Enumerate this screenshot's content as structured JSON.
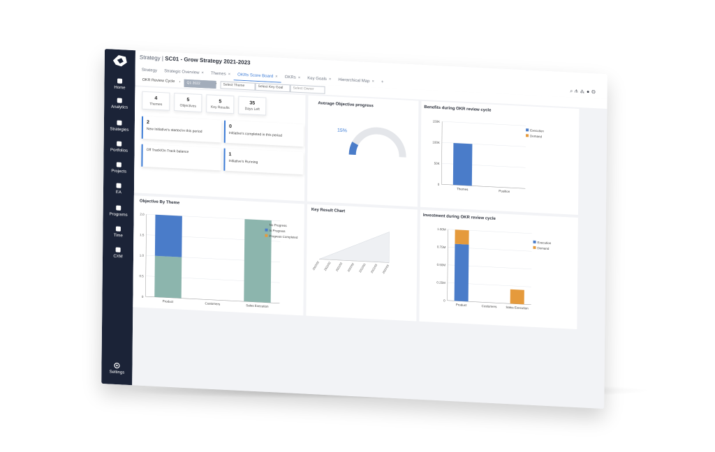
{
  "app": {
    "breadcrumb_prefix": "Strategy |",
    "breadcrumb_title": "SC01 - Grow Strategy 2021-2023"
  },
  "sidebar": {
    "items": [
      {
        "label": "Home",
        "icon": "home-icon"
      },
      {
        "label": "Analytics",
        "icon": "analytics-icon"
      },
      {
        "label": "Strategies",
        "icon": "strategy-icon"
      },
      {
        "label": "Portfolios",
        "icon": "portfolio-icon"
      },
      {
        "label": "Projects",
        "icon": "project-icon"
      },
      {
        "label": "EA",
        "icon": "ea-icon"
      },
      {
        "label": "Programs",
        "icon": "program-icon"
      },
      {
        "label": "Time",
        "icon": "time-icon"
      },
      {
        "label": "CXM",
        "icon": "cxm-icon"
      }
    ],
    "settings_label": "Settings"
  },
  "tabs": [
    {
      "label": "Strategy",
      "closable": false,
      "active": false
    },
    {
      "label": "Strategic Overview",
      "closable": true,
      "active": false
    },
    {
      "label": "Themes",
      "closable": true,
      "active": false
    },
    {
      "label": "OKRs Score Board",
      "closable": true,
      "active": true
    },
    {
      "label": "OKRs",
      "closable": true,
      "active": false
    },
    {
      "label": "Key Goals",
      "closable": true,
      "active": false
    },
    {
      "label": "Hierarchical Map",
      "closable": true,
      "active": false
    }
  ],
  "tab_add": "+",
  "tab_close": "×",
  "filters": {
    "cycle_label": "OKR Review Cycle",
    "cycle_value": "Q1 2022",
    "prev": "‹",
    "next": "›",
    "theme": "Select Theme",
    "goal": "Select Key Goal",
    "owner": "Select Owner"
  },
  "stats": [
    {
      "value": "4",
      "label": "Themes"
    },
    {
      "value": "5",
      "label": "Objectives"
    },
    {
      "value": "5",
      "label": "Key Results"
    },
    {
      "value": "35",
      "label": "Days Left"
    }
  ],
  "initiatives": [
    {
      "value": "2",
      "label": "New Initiative's started in this period"
    },
    {
      "value": "0",
      "label": "Initiative's completed in this period"
    },
    {
      "value": "",
      "label": "Off Track/On Track balance"
    },
    {
      "value": "1",
      "label": "Initiative's Running"
    }
  ],
  "avg_progress": {
    "title": "Average Objective progress",
    "value_text": "15%",
    "value": 0.15
  },
  "colors": {
    "blue": "#4a7cc9",
    "teal": "#8cb5ad",
    "orange": "#e59a3c",
    "navy": "#1b2337",
    "accent": "#3b7bd6"
  },
  "chart_data": [
    {
      "type": "bar",
      "title": "Benefits during OKR review cycle",
      "categories": [
        "Themes",
        "Position"
      ],
      "series": [
        {
          "name": "Execution",
          "values": [
            100000,
            0
          ]
        },
        {
          "name": "Demand",
          "values": [
            0,
            0
          ]
        }
      ],
      "yticks": [
        "0",
        "50K",
        "100K",
        "150K"
      ],
      "ylim": [
        0,
        150000
      ],
      "legend": "right"
    },
    {
      "type": "bar",
      "title": "Objective By Theme",
      "categories": [
        "Product",
        "Customers",
        "Sales Execution"
      ],
      "series": [
        {
          "name": "No Progress",
          "values": [
            1.0,
            0,
            2.0
          ]
        },
        {
          "name": "In Progress",
          "values": [
            1.0,
            0,
            0
          ]
        },
        {
          "name": "Progress Completed",
          "values": [
            0,
            0,
            0
          ]
        }
      ],
      "yticks": [
        "0",
        "0.5",
        "1.0",
        "1.5",
        "2.0"
      ],
      "ylim": [
        0,
        2.0
      ],
      "legend": "right"
    },
    {
      "type": "area",
      "title": "Key Result Chart",
      "x": [
        "2022/02",
        "2022/02",
        "2022/02",
        "2022/02",
        "2022/03",
        "2022/03",
        "2022/03"
      ],
      "values": [
        0,
        0.5,
        1,
        1.5,
        2,
        2.5,
        3
      ],
      "legend": "none"
    },
    {
      "type": "bar",
      "title": "Investment during OKR review cycle",
      "categories": [
        "Product",
        "Customers",
        "Sales Execution"
      ],
      "series": [
        {
          "name": "Execution",
          "values": [
            0.8,
            0,
            0
          ]
        },
        {
          "name": "Demand",
          "values": [
            0.2,
            0,
            0.2
          ]
        }
      ],
      "yticks": [
        "0",
        "0.25M",
        "0.50M",
        "0.75M",
        "1.00M"
      ],
      "ylim": [
        0,
        1.0
      ],
      "legend": "right"
    }
  ]
}
